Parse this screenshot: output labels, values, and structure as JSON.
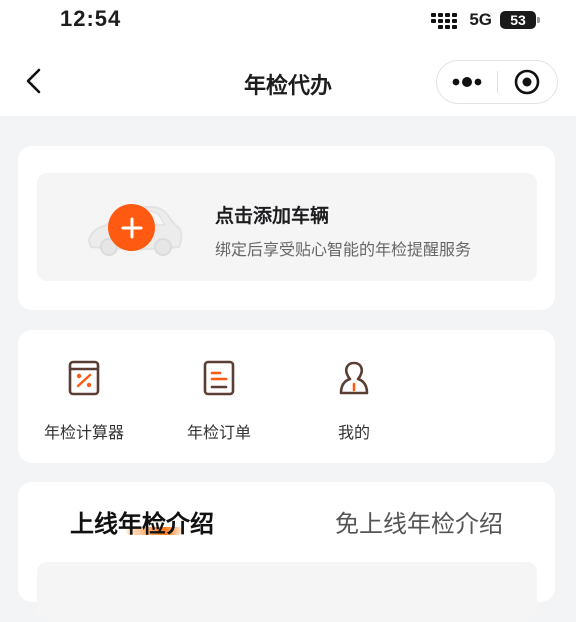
{
  "status_bar": {
    "time": "12:54",
    "network": "5G",
    "battery": "53"
  },
  "nav": {
    "title": "年检代办"
  },
  "add_vehicle": {
    "title": "点击添加车辆",
    "subtitle": "绑定后享受贴心智能的年检提醒服务"
  },
  "quick_links": [
    {
      "label": "年检计算器",
      "icon": "calculator-icon"
    },
    {
      "label": "年检订单",
      "icon": "order-icon"
    },
    {
      "label": "我的",
      "icon": "user-icon"
    }
  ],
  "tabs": [
    {
      "label": "上线年检介绍",
      "active": true
    },
    {
      "label": "免上线年检介绍",
      "active": false
    }
  ],
  "colors": {
    "accent": "#ff5a12",
    "icon_brown": "#5a3d33"
  }
}
